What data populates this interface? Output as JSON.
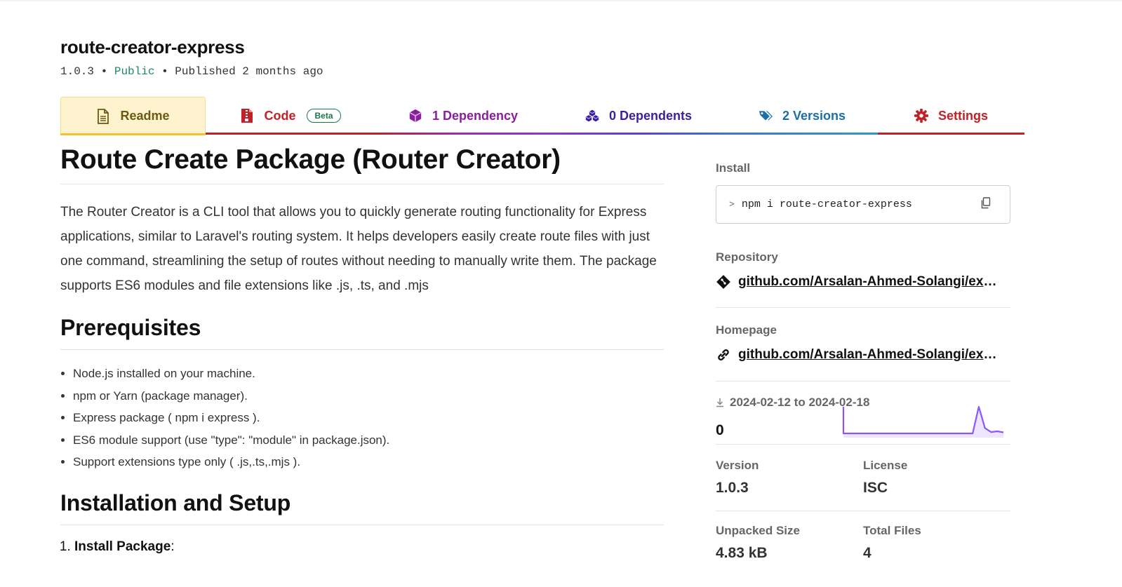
{
  "package": {
    "name": "route-creator-express",
    "version": "1.0.3",
    "visibility": "Public",
    "published": "Published 2 months ago",
    "separator": "•"
  },
  "tabs": [
    {
      "label": "Readme",
      "icon": "readme-file-icon",
      "color": "#6b5a12"
    },
    {
      "label": "Code",
      "icon": "code-file-icon",
      "badge": "Beta",
      "color": "#c12127"
    },
    {
      "label": "1 Dependency",
      "icon": "cube-icon",
      "color": "#8a1e9c"
    },
    {
      "label": "0 Dependents",
      "icon": "cubes-icon",
      "color": "#3b1fa0"
    },
    {
      "label": "2 Versions",
      "icon": "tags-icon",
      "color": "#1c6fa5"
    },
    {
      "label": "Settings",
      "icon": "gear-icon",
      "color": "#c12127"
    }
  ],
  "readme": {
    "title": "Route Create Package (Router Creator)",
    "intro": "The Router Creator is a CLI tool that allows you to quickly generate routing functionality for Express applications, similar to Laravel's routing system. It helps developers easily create route files with just one command, streamlining the setup of routes without needing to manually write them. The package supports ES6 modules and file extensions like .js, .ts, and .mjs",
    "prerequisites_heading": "Prerequisites",
    "prerequisites": [
      "Node.js installed on your machine.",
      "npm or Yarn (package manager).",
      "Express package ( npm i express ).",
      "ES6 module support (use \"type\": \"module\" in package.json).",
      "Support extensions type only ( .js,.ts,.mjs )."
    ],
    "install_heading": "Installation and Setup",
    "steps": [
      {
        "title": "Install Package",
        "suffix": ":"
      }
    ]
  },
  "sidebar": {
    "install_label": "Install",
    "install_prompt": ">",
    "install_command": "npm i route-creator-express",
    "repository_label": "Repository",
    "repository_link": "github.com/Arsalan-Ahmed-Solangi/express-route-creator",
    "homepage_label": "Homepage",
    "homepage_link": "github.com/Arsalan-Ahmed-Solangi/express-route-creator",
    "downloads_range": "2024-02-12 to 2024-02-18",
    "downloads_count": "0",
    "version_label": "Version",
    "version_value": "1.0.3",
    "license_label": "License",
    "license_value": "ISC",
    "unpacked_label": "Unpacked Size",
    "unpacked_value": "4.83 kB",
    "files_label": "Total Files",
    "files_value": "4"
  },
  "downloads_chart": {
    "type": "line",
    "values": [
      0,
      0,
      0,
      0,
      0,
      0,
      0,
      0,
      0,
      0,
      0,
      0,
      0,
      0,
      0,
      0,
      0,
      0,
      0,
      0,
      0,
      0,
      1,
      0.2,
      0.05,
      0.08,
      0.04
    ],
    "color": "#8956ff"
  },
  "colors": {
    "accent_readme": "#f1c232",
    "accent_code": "#c12127",
    "beta_badge": "#1a7a45",
    "public": "#1a8a6b"
  }
}
